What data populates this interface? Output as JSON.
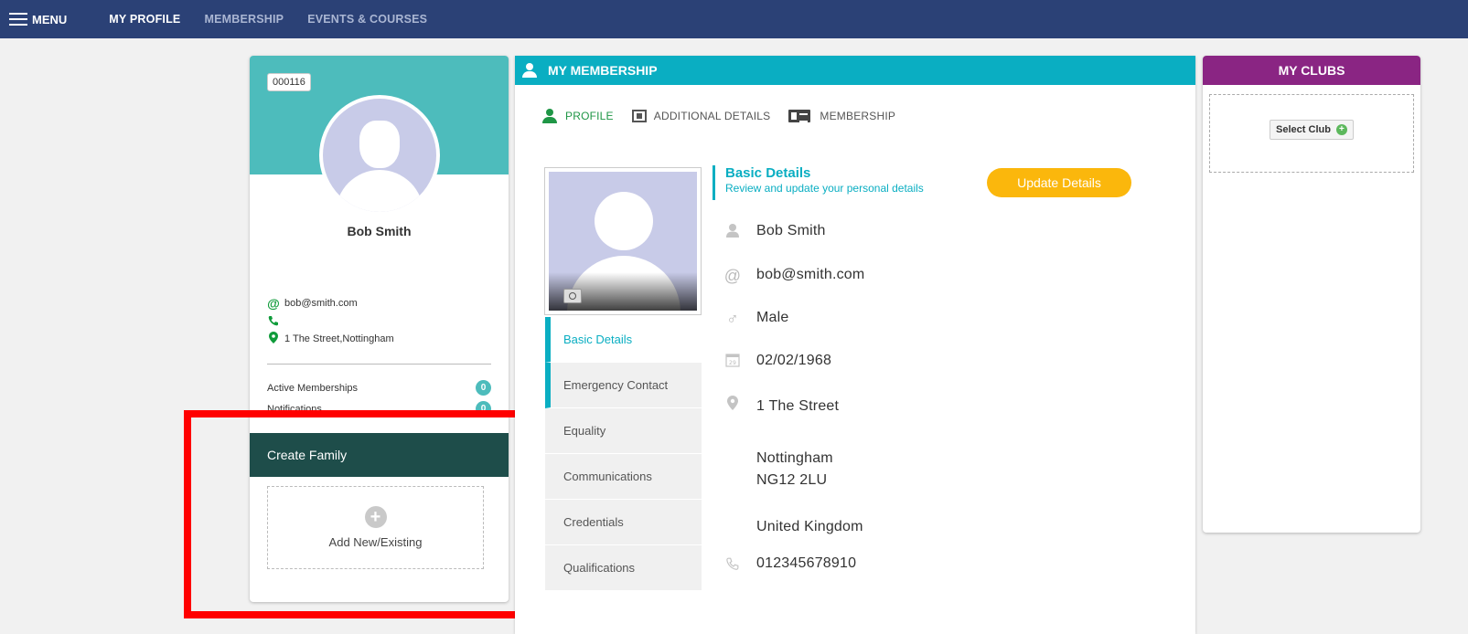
{
  "nav": {
    "menu_label": "MENU",
    "links": [
      "MY PROFILE",
      "MEMBERSHIP",
      "EVENTS & COURSES"
    ]
  },
  "profile": {
    "member_id": "000116",
    "name": "Bob Smith",
    "email": "bob@smith.com",
    "address": "1 The Street,Nottingham",
    "stats": [
      {
        "label": "Active Memberships",
        "count": "0"
      },
      {
        "label": "Notifications",
        "count": "0"
      }
    ],
    "family_header": "Create Family",
    "add_family_label": "Add New/Existing"
  },
  "membership": {
    "header": "MY MEMBERSHIP",
    "subtabs": [
      "PROFILE",
      "ADDITIONAL DETAILS",
      "MEMBERSHIP"
    ],
    "side_tabs": [
      "Basic Details",
      "Emergency Contact",
      "Equality",
      "Communications",
      "Credentials",
      "Qualifications"
    ],
    "details_title": "Basic Details",
    "details_subtitle": "Review and update your personal details",
    "update_button": "Update Details",
    "fields": {
      "name": "Bob Smith",
      "email": "bob@smith.com",
      "gender": "Male",
      "dob": "02/02/1968",
      "address_line1": "1 The Street",
      "city": "Nottingham",
      "postcode": "NG12 2LU",
      "country": "United Kingdom",
      "phone": "012345678910"
    }
  },
  "clubs": {
    "header": "MY CLUBS",
    "select_label": "Select Club"
  },
  "colors": {
    "nav": "#2b4176",
    "teal": "#4dbcbc",
    "membership_header": "#0aaec2",
    "clubs_header": "#8a2583",
    "update_button": "#fbb70c",
    "family_header": "#1e4d4a",
    "highlight": "#ff0000"
  }
}
